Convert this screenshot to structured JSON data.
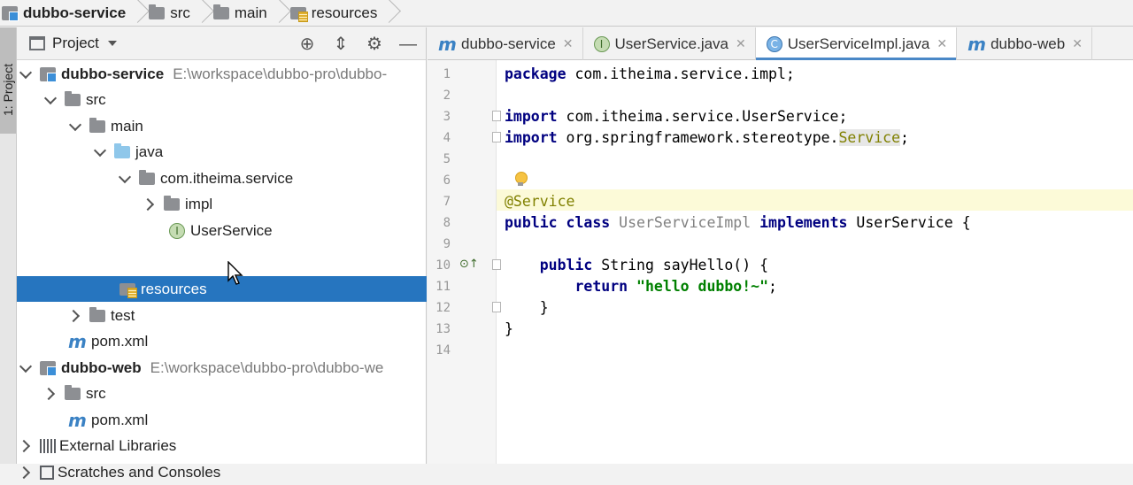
{
  "navbar": {
    "crumbs": [
      {
        "label": "dubbo-service",
        "icon": "module-icon"
      },
      {
        "label": "src",
        "icon": "folder-icon"
      },
      {
        "label": "main",
        "icon": "folder-icon"
      },
      {
        "label": "resources",
        "icon": "resources-folder-icon"
      }
    ]
  },
  "toolstrip": {
    "project_tab": "1: Project"
  },
  "project_panel": {
    "title": "Project",
    "tree": [
      {
        "label": "dubbo-service",
        "path": "E:\\workspace\\dubbo-pro\\dubbo-"
      },
      {
        "label": "src"
      },
      {
        "label": "main"
      },
      {
        "label": "java"
      },
      {
        "label": "com.itheima.service"
      },
      {
        "label": "impl"
      },
      {
        "label": "UserService"
      },
      {
        "label": "resources"
      },
      {
        "label": "test"
      },
      {
        "label": "pom.xml"
      },
      {
        "label": "dubbo-web",
        "path": "E:\\workspace\\dubbo-pro\\dubbo-we"
      },
      {
        "label": "src"
      },
      {
        "label": "pom.xml"
      },
      {
        "label": "External Libraries"
      },
      {
        "label": "Scratches and Consoles"
      }
    ]
  },
  "tabs": [
    {
      "label": "dubbo-service"
    },
    {
      "label": "UserService.java"
    },
    {
      "label": "UserServiceImpl.java"
    },
    {
      "label": "dubbo-web"
    }
  ],
  "editor": {
    "line_numbers": [
      "1",
      "2",
      "3",
      "4",
      "5",
      "6",
      "7",
      "8",
      "9",
      "10",
      "11",
      "12",
      "13",
      "14"
    ],
    "code": {
      "l1_kw": "package",
      "l1_rest": " com.itheima.service.impl;",
      "l3_kw": "import",
      "l3_rest": " com.itheima.service.UserService;",
      "l4_kw": "import",
      "l4_rest": " org.springframework.stereotype.",
      "l4_hl": "Service",
      "l4_end": ";",
      "l7_ann": "@Service",
      "l8_kw1": "public class",
      "l8_name": " UserServiceImpl",
      "l8_kw2": " implements",
      "l8_rest": " UserService {",
      "l10_kw": "    public",
      "l10_rest": " String sayHello() {",
      "l11_kw": "        return",
      "l11_str": " \"hello dubbo!~\"",
      "l11_end": ";",
      "l12": "    }",
      "l13": "}"
    }
  }
}
